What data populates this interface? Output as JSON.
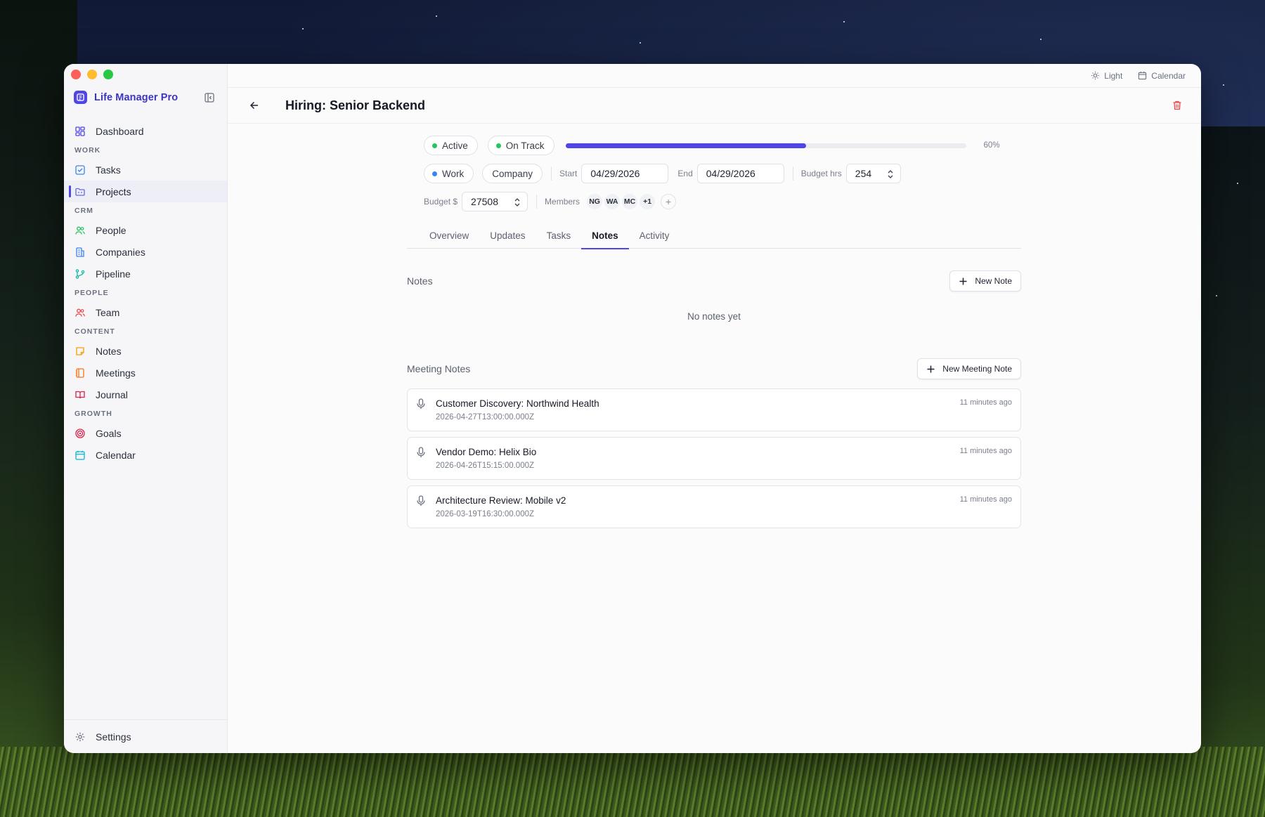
{
  "app": {
    "name": "Life Manager Pro"
  },
  "sidebar": {
    "dashboard": "Dashboard",
    "sections": {
      "work": "WORK",
      "crm": "CRM",
      "people": "PEOPLE",
      "content": "CONTENT",
      "growth": "GROWTH"
    },
    "items": {
      "tasks": "Tasks",
      "projects": "Projects",
      "people": "People",
      "companies": "Companies",
      "pipeline": "Pipeline",
      "team": "Team",
      "notes": "Notes",
      "meetings": "Meetings",
      "journal": "Journal",
      "goals": "Goals",
      "calendar": "Calendar"
    },
    "active": "projects",
    "settings": "Settings"
  },
  "topbar": {
    "theme_label": "Light",
    "calendar_label": "Calendar"
  },
  "header": {
    "title": "Hiring: Senior Backend"
  },
  "project": {
    "status": "Active",
    "health": "On Track",
    "progress_pct": 60,
    "progress_label": "60%",
    "area": "Work",
    "company": "Company",
    "start_label": "Start",
    "start_date": "04/29/2026",
    "end_label": "End",
    "end_date": "04/29/2026",
    "budget_hrs_label": "Budget hrs",
    "budget_hrs": "254",
    "budget_usd_label": "Budget $",
    "budget_usd": "27508",
    "members_label": "Members",
    "members": [
      "NG",
      "WA",
      "MC"
    ],
    "members_more": "+1",
    "add_member": "+"
  },
  "colors": {
    "accent": "#4f46e5",
    "status_active": "#22c55e",
    "health_on_track": "#22c55e",
    "area_work": "#3b82f6",
    "danger": "#ef4444"
  },
  "tabs": {
    "overview": "Overview",
    "updates": "Updates",
    "tasks": "Tasks",
    "notes": "Notes",
    "activity": "Activity",
    "active": "notes"
  },
  "notes_section": {
    "title": "Notes",
    "new_button": "New Note",
    "empty_text": "No notes yet"
  },
  "meeting_section": {
    "title": "Meeting Notes",
    "new_button": "New Meeting Note",
    "items": [
      {
        "title": "Customer Discovery: Northwind Health",
        "date": "2026-04-27T13:00:00.000Z",
        "ago": "11 minutes ago"
      },
      {
        "title": "Vendor Demo: Helix Bio",
        "date": "2026-04-26T15:15:00.000Z",
        "ago": "11 minutes ago"
      },
      {
        "title": "Architecture Review: Mobile v2",
        "date": "2026-03-19T16:30:00.000Z",
        "ago": "11 minutes ago"
      }
    ]
  }
}
